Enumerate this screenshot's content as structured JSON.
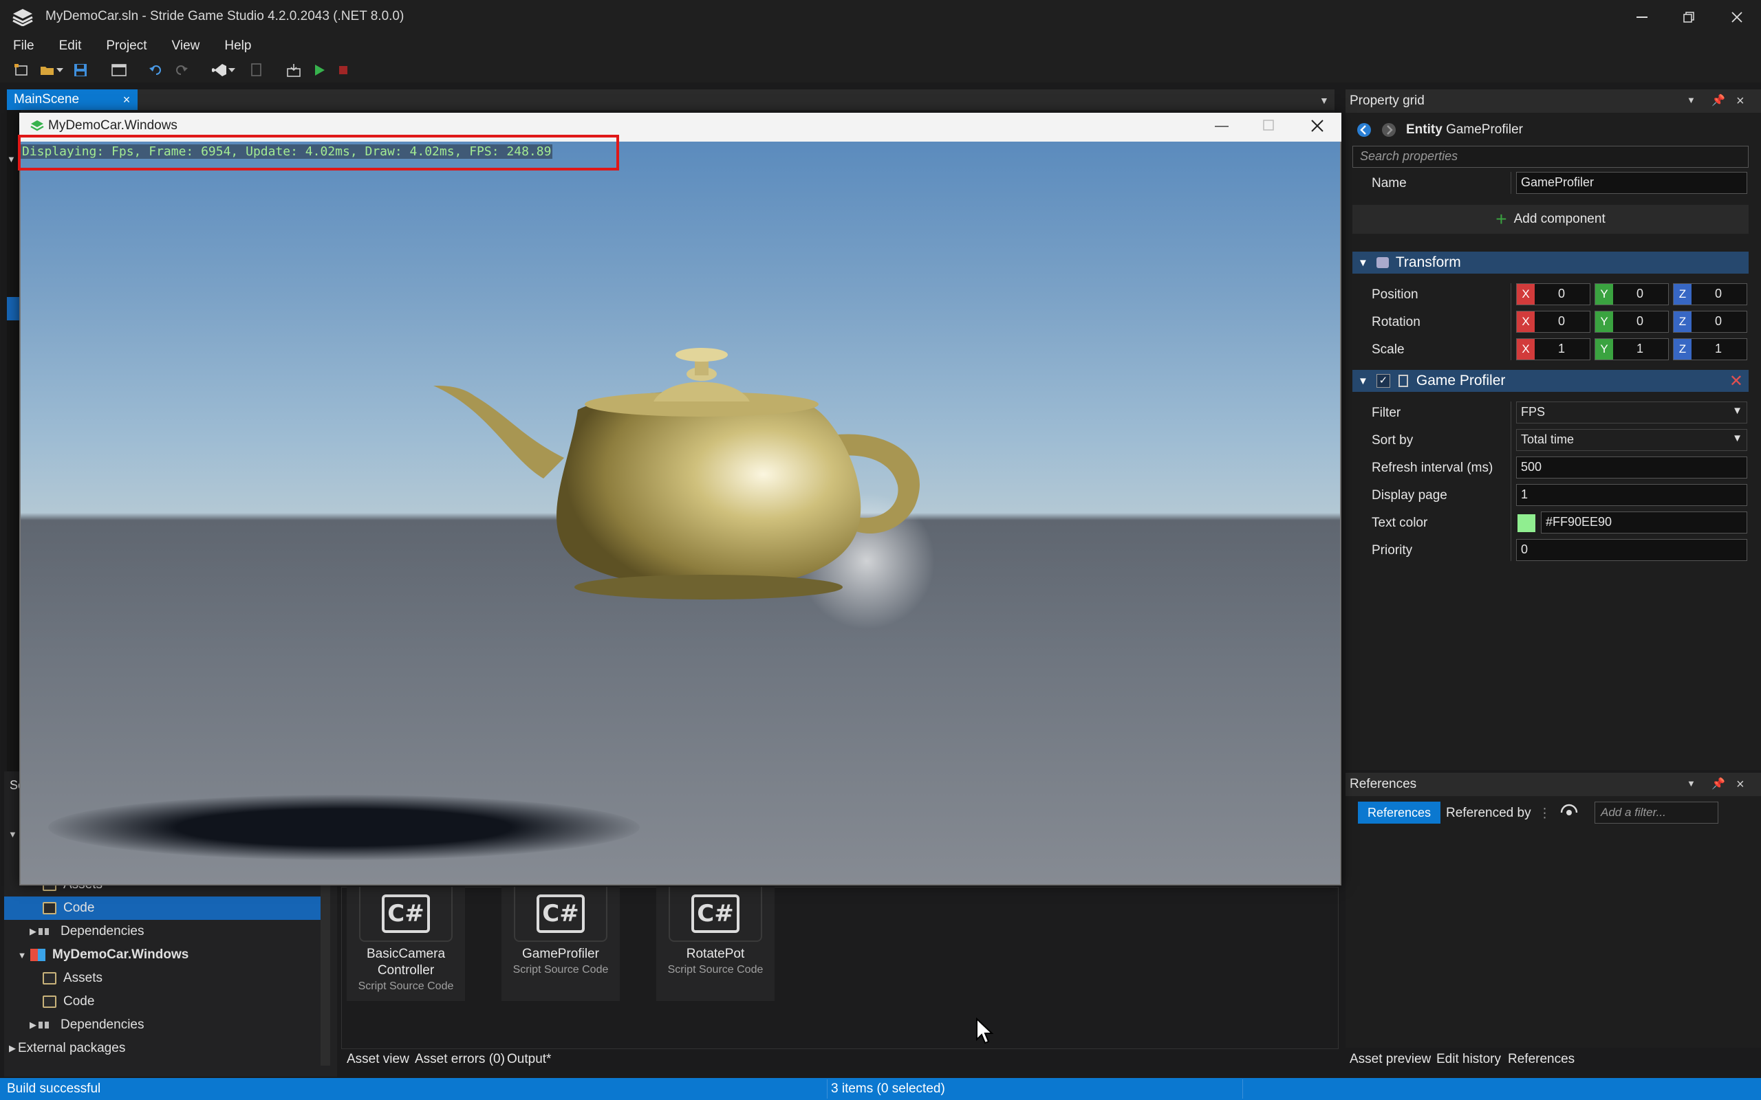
{
  "window": {
    "title": "MyDemoCar.sln - Stride Game Studio 4.2.0.2043 (.NET 8.0.0)"
  },
  "menu": [
    "File",
    "Edit",
    "Project",
    "View",
    "Help"
  ],
  "scene": {
    "tab_label": "MainScene"
  },
  "game_window": {
    "title": "MyDemoCar.Windows",
    "profiler_text": "Displaying: Fps, Frame: 6954, Update: 4.02ms, Draw: 4.02ms, FPS: 248.89"
  },
  "solution_tree": {
    "panel_title": "Sc",
    "rows": [
      {
        "label": "Assets"
      },
      {
        "label": "Code"
      },
      {
        "label": "Dependencies"
      },
      {
        "label": "MyDemoCar.Windows"
      },
      {
        "label": "Assets"
      },
      {
        "label": "Code"
      },
      {
        "label": "Dependencies"
      },
      {
        "label": "External packages"
      }
    ]
  },
  "assets": [
    {
      "name": "BasicCamera Controller",
      "name_line1": "BasicCamera",
      "name_line2": "Controller",
      "type": "Script Source Code"
    },
    {
      "name": "GameProfiler",
      "type": "Script Source Code"
    },
    {
      "name": "RotatePot",
      "type": "Script Source Code"
    }
  ],
  "bottom_tabs": [
    "Asset view",
    "Asset errors (0)",
    "Output*"
  ],
  "status": {
    "left": "Build successful",
    "center": "3 items (0 selected)"
  },
  "property_grid": {
    "title": "Property grid",
    "entity_kind": "Entity",
    "entity_name": "GameProfiler",
    "search_placeholder": "Search properties",
    "name_label": "Name",
    "name_value": "GameProfiler",
    "add_component": "Add component",
    "transform": {
      "title": "Transform",
      "position_label": "Position",
      "rotation_label": "Rotation",
      "scale_label": "Scale",
      "axis_x": "X",
      "axis_y": "Y",
      "axis_z": "Z",
      "position": [
        "0",
        "0",
        "0"
      ],
      "rotation": [
        "0",
        "0",
        "0"
      ],
      "scale": [
        "1",
        "1",
        "1"
      ]
    },
    "game_profiler": {
      "title": "Game Profiler",
      "checkmark": "✓",
      "filter_label": "Filter",
      "filter_value": "FPS",
      "sortby_label": "Sort by",
      "sortby_value": "Total time",
      "refresh_label": "Refresh interval (ms)",
      "refresh_value": "500",
      "page_label": "Display page",
      "page_value": "1",
      "color_label": "Text color",
      "color_value": "#FF90EE90",
      "color_swatch": "#90EE90",
      "priority_label": "Priority",
      "priority_value": "0"
    }
  },
  "references": {
    "title": "References",
    "tab_references": "References",
    "tab_referenced_by": "Referenced by",
    "filter_placeholder": "Add a filter..."
  },
  "right_bottom_tabs": [
    "Asset preview",
    "Edit history",
    "References"
  ]
}
